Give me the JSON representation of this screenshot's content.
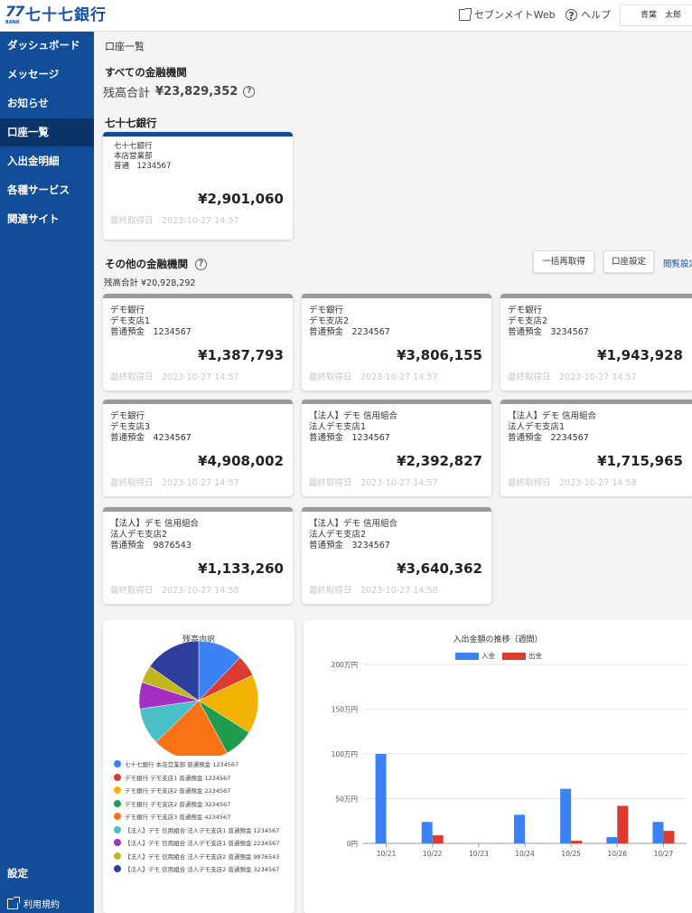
{
  "header": {
    "logo_num": "77",
    "logo_bank": "BANK",
    "logo_text": "七十七銀行",
    "sevenmate_label": "セブンメイトWeb",
    "help_label": "ヘルプ",
    "user_name": "青葉　太郎"
  },
  "sidebar": {
    "items": [
      {
        "label": "ダッシュボード"
      },
      {
        "label": "メッセージ"
      },
      {
        "label": "お知らせ"
      },
      {
        "label": "口座一覧"
      },
      {
        "label": "入出金明細"
      },
      {
        "label": "各種サービス"
      },
      {
        "label": "関連サイト"
      }
    ],
    "active_index": 3,
    "settings_label": "設定",
    "terms_label": "利用規約"
  },
  "main": {
    "breadcrumb": "口座一覧",
    "all_heading": "すべての金融機関",
    "all_total_label": "残高合計",
    "all_total_amount": "¥23,829,352",
    "bank77_heading": "七十七銀行",
    "bank77_card": {
      "bank": "七十七銀行",
      "branch": "本店営業部",
      "account": "普通　1234567",
      "balance": "¥2,901,060",
      "updated": "最終取得日　2023-10-27 14:57"
    },
    "other_heading": "その他の金融機関",
    "other_total": "残高合計 ¥20,928,292",
    "refresh_all_button": "一括再取得",
    "account_settings_button": "口座設定",
    "view_settings_link": "閲覧設定",
    "other_cards": [
      {
        "bank": "デモ銀行",
        "branch": "デモ支店1",
        "account": "普通預金　1234567",
        "balance": "¥1,387,793",
        "updated": "最終取得日　2023-10-27 14:57"
      },
      {
        "bank": "デモ銀行",
        "branch": "デモ支店2",
        "account": "普通預金　2234567",
        "balance": "¥3,806,155",
        "updated": "最終取得日　2023-10-27 14:57"
      },
      {
        "bank": "デモ銀行",
        "branch": "デモ支店2",
        "account": "普通預金　3234567",
        "balance": "¥1,943,928",
        "updated": "最終取得日　2023-10-27 14:57"
      },
      {
        "bank": "デモ銀行",
        "branch": "デモ支店3",
        "account": "普通預金　4234567",
        "balance": "¥4,908,002",
        "updated": "最終取得日　2023-10-27 14:57"
      },
      {
        "bank": "【法人】デモ 信用組合",
        "branch": "法人デモ支店1",
        "account": "普通預金　1234567",
        "balance": "¥2,392,827",
        "updated": "最終取得日　2023-10-27 14:57"
      },
      {
        "bank": "【法人】デモ 信用組合",
        "branch": "法人デモ支店1",
        "account": "普通預金　2234567",
        "balance": "¥1,715,965",
        "updated": "最終取得日　2023-10-27 14:58"
      },
      {
        "bank": "【法人】デモ 信用組合",
        "branch": "法人デモ支店2",
        "account": "普通預金　9876543",
        "balance": "¥1,133,260",
        "updated": "最終取得日　2023-10-27 14:58"
      },
      {
        "bank": "【法人】デモ 信用組合",
        "branch": "法人デモ支店2",
        "account": "普通預金　3234567",
        "balance": "¥3,640,362",
        "updated": "最終取得日　2023-10-27 14:58"
      }
    ]
  },
  "colors": {
    "sidebar": "#114d99",
    "sidebar_active": "#0c3468",
    "deposit": "#3b82f6",
    "withdrawal": "#dc3b2f"
  },
  "chart_data": [
    {
      "type": "pie",
      "title": "残高内訳",
      "labels": [
        "七十七銀行 本店営業部 普通預金 1234567",
        "デモ銀行 デモ支店1 普通預金 1234567",
        "デモ銀行 デモ支店2 普通預金 2234567",
        "デモ銀行 デモ支店2 普通預金 3234567",
        "デモ銀行 デモ支店3 普通預金 4234567",
        "【法人】デモ 信用組合 法人デモ支店1 普通預金 1234567",
        "【法人】デモ 信用組合 法人デモ支店1 普通預金 2234567",
        "【法人】デモ 信用組合 法人デモ支店2 普通預金 9876543",
        "【法人】デモ 信用組合 法人デモ支店2 普通預金 3234567"
      ],
      "values": [
        2901060,
        1387793,
        3806155,
        1943928,
        4908002,
        2392827,
        1715965,
        1133260,
        3640362
      ],
      "colors": [
        "#3b82f6",
        "#dc3b2f",
        "#f2b200",
        "#1f9d4c",
        "#f97316",
        "#4bbfc8",
        "#a22fc2",
        "#c2b61e",
        "#2e3e9c"
      ],
      "legend_position": "bottom"
    },
    {
      "type": "bar",
      "title": "入出金額の推移（週間）",
      "categories": [
        "10/21",
        "10/22",
        "10/23",
        "10/24",
        "10/25",
        "10/26",
        "10/27"
      ],
      "series": [
        {
          "name": "入金",
          "values": [
            100,
            24,
            0,
            32,
            61,
            7,
            24
          ]
        },
        {
          "name": "出金",
          "values": [
            0,
            9,
            0,
            0,
            3,
            42,
            14
          ]
        }
      ],
      "ylim": [
        0,
        200
      ],
      "yticks": [
        0,
        50,
        100,
        150,
        200
      ],
      "ytick_labels": [
        "0円",
        "50万円",
        "100万円",
        "150万円",
        "200万円"
      ],
      "legend_position": "top",
      "grid": true
    }
  ]
}
